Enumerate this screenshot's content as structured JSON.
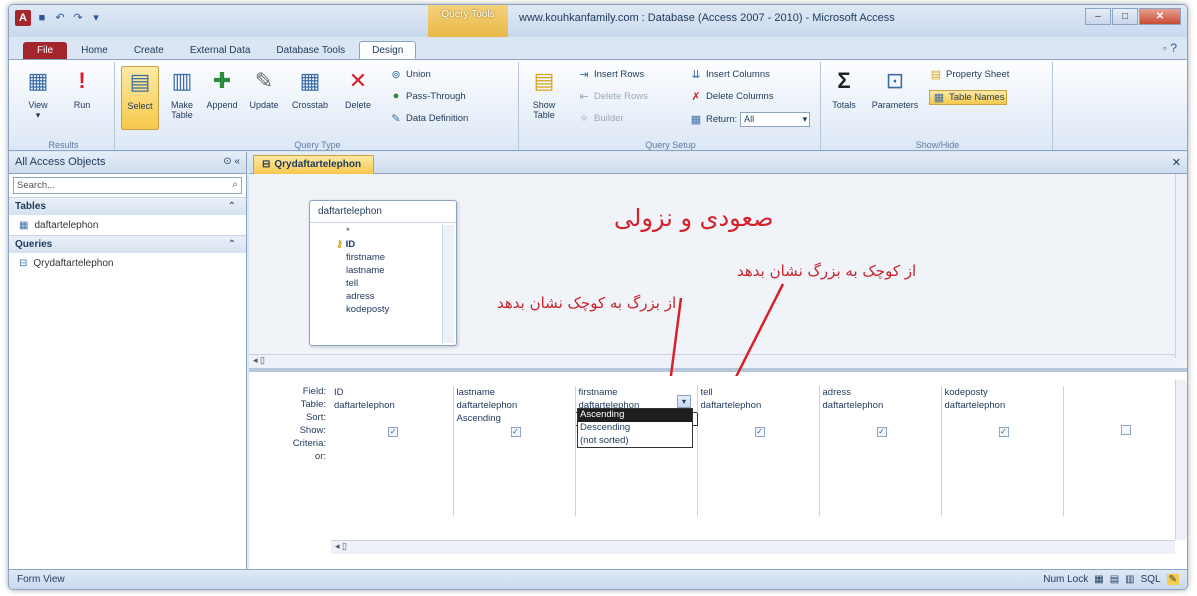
{
  "window": {
    "title": "www.kouhkanfamily.com : Database (Access 2007 - 2010) - Microsoft Access",
    "context_tab": "Query Tools",
    "app_icon": "A"
  },
  "tabs": [
    {
      "label": "File"
    },
    {
      "label": "Home"
    },
    {
      "label": "Create"
    },
    {
      "label": "External Data"
    },
    {
      "label": "Database Tools"
    },
    {
      "label": "Design"
    }
  ],
  "ribbon": {
    "results": {
      "label": "Results",
      "view": "View",
      "run": "Run"
    },
    "query_type": {
      "label": "Query Type",
      "select": "Select",
      "make_table": "Make Table",
      "append": "Append",
      "update": "Update",
      "crosstab": "Crosstab",
      "delete": "Delete",
      "union": "Union",
      "pass_through": "Pass-Through",
      "data_definition": "Data Definition"
    },
    "query_setup": {
      "label": "Query Setup",
      "show_table": "Show Table",
      "insert_rows": "Insert Rows",
      "delete_rows": "Delete Rows",
      "builder": "Builder",
      "insert_columns": "Insert Columns",
      "delete_columns": "Delete Columns",
      "return_label": "Return:",
      "return_value": "All"
    },
    "show_hide": {
      "label": "Show/Hide",
      "totals": "Totals",
      "parameters": "Parameters",
      "property_sheet": "Property Sheet",
      "table_names": "Table Names"
    }
  },
  "nav": {
    "title": "All Access Objects",
    "search_placeholder": "Search...",
    "sections": [
      {
        "name": "Tables",
        "items": [
          "daftartelephon"
        ]
      },
      {
        "name": "Queries",
        "items": [
          "Qrydaftartelephon"
        ]
      }
    ]
  },
  "document": {
    "tab": "Qrydaftartelephon",
    "table_box": {
      "name": "daftartelephon",
      "fields": [
        "*",
        "ID",
        "firstname",
        "lastname",
        "tell",
        "adress",
        "kodeposty"
      ]
    },
    "annotations": {
      "main": "صعودی و نزولی",
      "asc_note": "از کوچک به بزرگ نشان بدهد",
      "desc_note": "از بزرگ به کوچک نشان بدهد"
    },
    "grid": {
      "row_labels": [
        "Field:",
        "Table:",
        "Sort:",
        "Show:",
        "Criteria:",
        "or:"
      ],
      "columns": [
        {
          "field": "ID",
          "table": "daftartelephon",
          "sort": "",
          "show": true
        },
        {
          "field": "lastname",
          "table": "daftartelephon",
          "sort": "Ascending",
          "show": true
        },
        {
          "field": "firstname",
          "table": "daftartelephon",
          "sort": "",
          "show": true
        },
        {
          "field": "tell",
          "table": "daftartelephon",
          "sort": "",
          "show": true
        },
        {
          "field": "adress",
          "table": "daftartelephon",
          "sort": "",
          "show": true
        },
        {
          "field": "kodeposty",
          "table": "daftartelephon",
          "sort": "",
          "show": true
        },
        {
          "field": "",
          "table": "",
          "sort": "",
          "show": false
        }
      ],
      "sort_options": [
        "Ascending",
        "Descending",
        "(not sorted)"
      ]
    }
  },
  "status": {
    "left": "Form View",
    "num_lock": "Num Lock"
  }
}
